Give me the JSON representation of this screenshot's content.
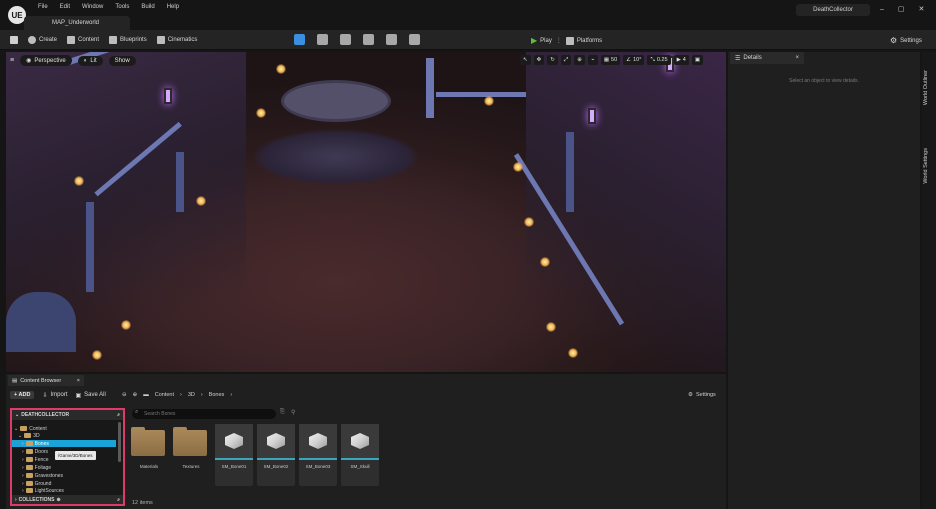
{
  "titlebar": {
    "logo": "UE",
    "menu": [
      "File",
      "Edit",
      "Window",
      "Tools",
      "Build",
      "Help"
    ],
    "map_tab": "MAP_Underworld",
    "project_name": "DeathCollector",
    "controls": [
      "–",
      "▢",
      "✕"
    ]
  },
  "toolbar": {
    "create": "Create",
    "content": "Content",
    "blueprints": "Blueprints",
    "cinematics": "Cinematics",
    "play": "Play",
    "platforms": "Platforms",
    "settings": "Settings"
  },
  "viewport": {
    "menu_icon": "≡",
    "perspective": "Perspective",
    "lit": "Lit",
    "show": "Show",
    "grid_value": "50",
    "angle_value": "10°",
    "scale_value": "0.25",
    "camera_speed": "4"
  },
  "details": {
    "tab_label": "Details",
    "empty_message": "Select an object to view details.",
    "close": "×"
  },
  "side_tabs": {
    "world_outliner": "World Outliner",
    "world_settings": "World Settings"
  },
  "content_browser": {
    "tab_label": "Content Browser",
    "close": "×",
    "add": "+ ADD",
    "import": "Import",
    "save_all": "Save All",
    "breadcrumbs": [
      "Content",
      "3D",
      "Bones"
    ],
    "settings": "Settings",
    "search_placeholder": "Search Bones",
    "tree": {
      "header": "DEATHCOLLECTOR",
      "items": [
        "Content",
        "3D",
        "Bones",
        "Doors",
        "Fence",
        "Foliage",
        "Gravestones",
        "Ground",
        "LightSources"
      ],
      "tooltip": "/Game/3D/Bones",
      "collections": "COLLECTIONS"
    },
    "assets": [
      {
        "name": "Materials",
        "kind": "folder"
      },
      {
        "name": "Textures",
        "kind": "folder"
      },
      {
        "name": "SM_Bone01",
        "kind": "mesh"
      },
      {
        "name": "SM_Bone02",
        "kind": "mesh"
      },
      {
        "name": "SM_Bone03",
        "kind": "mesh"
      },
      {
        "name": "SM_Skull",
        "kind": "mesh"
      }
    ],
    "item_count": "12 items"
  },
  "colors": {
    "highlight_border": "#e03a6a",
    "selection": "#1aa3d6",
    "play_green": "#5fbf3a",
    "mesh_accent": "#3aa6b9"
  }
}
